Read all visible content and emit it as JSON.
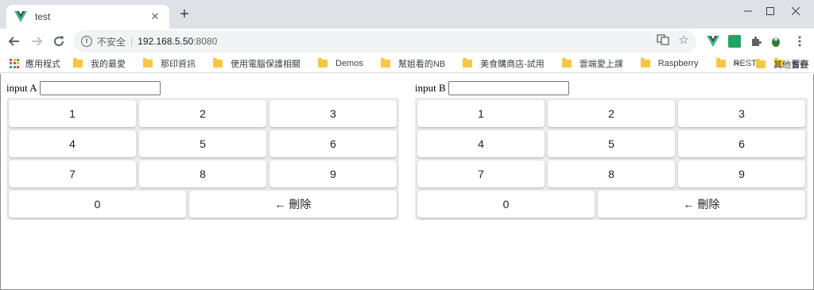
{
  "browser": {
    "tab_title": "test",
    "new_tab_label": "+",
    "address": {
      "security_label": "不安全",
      "host": "192.168.5.50",
      "port": ":8080"
    },
    "bookmarks": [
      {
        "label": "應用程式",
        "icon": "apps-grid-icon"
      },
      {
        "label": "我的最愛",
        "icon": "folder-icon"
      },
      {
        "label": "那印資訊",
        "icon": "folder-icon"
      },
      {
        "label": "使用電腦保護相關",
        "icon": "folder-icon"
      },
      {
        "label": "Demos",
        "icon": "folder-icon"
      },
      {
        "label": "幫姐看的NB",
        "icon": "folder-icon"
      },
      {
        "label": "美食購商店-試用",
        "icon": "folder-icon"
      },
      {
        "label": "雲端愛上課",
        "icon": "folder-icon"
      },
      {
        "label": "Raspberry",
        "icon": "folder-icon"
      },
      {
        "label": "REST",
        "icon": "folder-icon"
      },
      {
        "label": "暫存",
        "icon": "folder-icon"
      }
    ],
    "bookmarks_more": "»",
    "other_bookmarks": "其他書籤"
  },
  "panels": [
    {
      "label": "input A",
      "value": "",
      "keys": [
        [
          "1",
          "2",
          "3"
        ],
        [
          "4",
          "5",
          "6"
        ],
        [
          "7",
          "8",
          "9"
        ]
      ],
      "zero": "0",
      "delete": "← 刪除"
    },
    {
      "label": "input B",
      "value": "",
      "keys": [
        [
          "1",
          "2",
          "3"
        ],
        [
          "4",
          "5",
          "6"
        ],
        [
          "7",
          "8",
          "9"
        ]
      ],
      "zero": "0",
      "delete": "← 刪除"
    }
  ],
  "colors": {
    "vue_green": "#41b883",
    "vue_dark": "#35495e",
    "folder": "#f7c744",
    "extension_green": "#1fa463"
  }
}
